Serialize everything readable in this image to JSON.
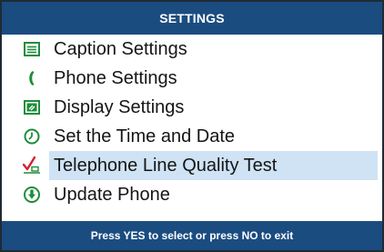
{
  "header": {
    "title": "SETTINGS"
  },
  "menu": {
    "items": [
      {
        "label": "Caption Settings",
        "icon": "caption-icon",
        "selected": false
      },
      {
        "label": "Phone Settings",
        "icon": "phone-handset-icon",
        "selected": false
      },
      {
        "label": "Display Settings",
        "icon": "display-icon",
        "selected": false
      },
      {
        "label": "Set the Time and Date",
        "icon": "clock-icon",
        "selected": false
      },
      {
        "label": "Telephone Line Quality Test",
        "icon": "line-test-icon",
        "selected": true
      },
      {
        "label": "Update Phone",
        "icon": "download-arrow-icon",
        "selected": false
      }
    ]
  },
  "footer": {
    "hint": "Press YES to select or press NO to exit"
  },
  "colors": {
    "bar": "#1b4c80",
    "icon_green": "#1e8d3b",
    "icon_red": "#d22030",
    "highlight": "#cfe3f5"
  }
}
